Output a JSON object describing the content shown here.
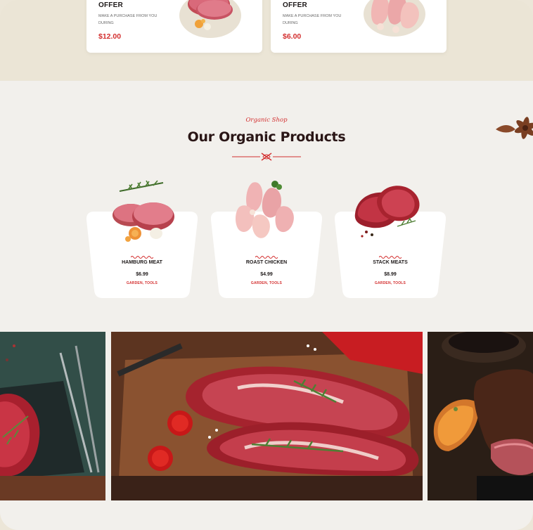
{
  "offers": [
    {
      "title": "OFFER",
      "desc": "MAKE A PURCHASE FROM YOU DURING",
      "price": "$12.00",
      "image": "ground-meat-patties"
    },
    {
      "title": "OFFER",
      "desc": "MAKE A PURCHASE FROM YOU DURING",
      "price": "$6.00",
      "image": "chicken-legs"
    }
  ],
  "section": {
    "eyebrow": "Organic Shop",
    "title": "Our Organic Products"
  },
  "products": [
    {
      "name": "HAMBURG MEAT",
      "price": "$6.99",
      "tags": "GARDEN, TOOLS",
      "image": "hamburg-meat"
    },
    {
      "name": "ROAST CHICKEN",
      "price": "$4.99",
      "tags": "GARDEN, TOOLS",
      "image": "roast-chicken"
    },
    {
      "name": "STACK MEATS",
      "price": "$8.99",
      "tags": "GARDEN, TOOLS",
      "image": "steak-meat"
    }
  ],
  "gallery": [
    {
      "image": "raw-steak-on-slate"
    },
    {
      "image": "raw-beef-on-board"
    },
    {
      "image": "grilled-steak"
    }
  ],
  "colors": {
    "accent": "#d32f2f",
    "heading": "#2a1616",
    "strip_bg": "#ebe5d6",
    "section_bg": "#f2f0ec"
  }
}
